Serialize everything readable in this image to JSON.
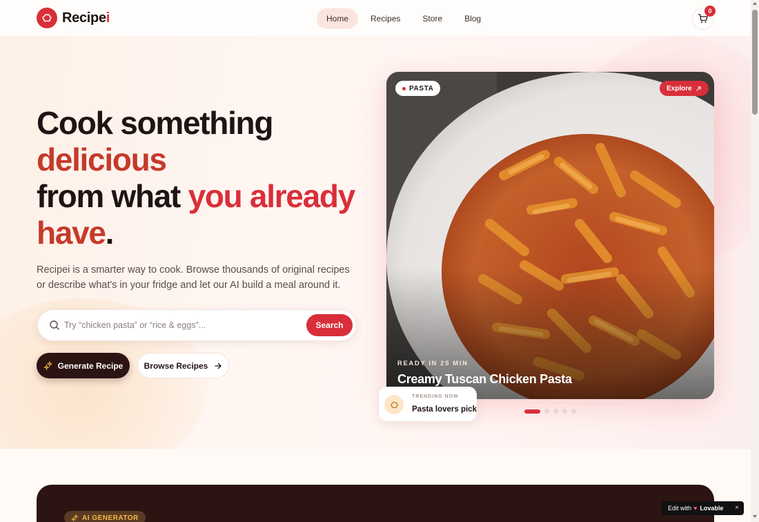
{
  "header": {
    "logo_text": "Recipe",
    "logo_accent": "i",
    "nav": [
      "Home",
      "Recipes",
      "Store",
      "Blog"
    ],
    "cart_count": "0"
  },
  "hero": {
    "headline": {
      "line1": "Cook something",
      "line2": "delicious",
      "line3_a": "from what ",
      "line3_b": "you already",
      "line4": "have",
      "period": "."
    },
    "subcopy": "Recipei is a smarter way to cook. Browse thousands of original recipes or describe what's in your fridge and let our AI build a meal around it.",
    "search": {
      "placeholder": "Try “chicken pasta” or “rice & eggs”...",
      "value": "",
      "button": "Search"
    },
    "generate_button": "Generate Recipe",
    "browse_button": "Browse Recipes"
  },
  "featured": {
    "tag": "PASTA",
    "explore": "Explore",
    "ready": "READY IN 25 MIN",
    "title": "Creamy Tuscan Chicken Pasta",
    "trend_kicker": "TRENDING NOW",
    "trend_label": "Pasta lovers pick",
    "slides_total": 5,
    "active_slide": 1
  },
  "ai_section": {
    "badge": "AI GENERATOR"
  },
  "lovable": {
    "prefix": "Edit with",
    "brand": "Lovable",
    "close": "×"
  },
  "colors": {
    "brand_red": "#d92f3a",
    "dark_brown": "#2b1412",
    "hero_bg": "#fff6f2"
  },
  "icons": {
    "logo": "chef-hat-icon",
    "cart": "shopping-cart-icon",
    "search": "search-icon",
    "generate": "sparkles-icon",
    "browse": "arrow-right-icon",
    "explore": "arrow-up-right-icon",
    "trend": "chef-hat-icon"
  }
}
